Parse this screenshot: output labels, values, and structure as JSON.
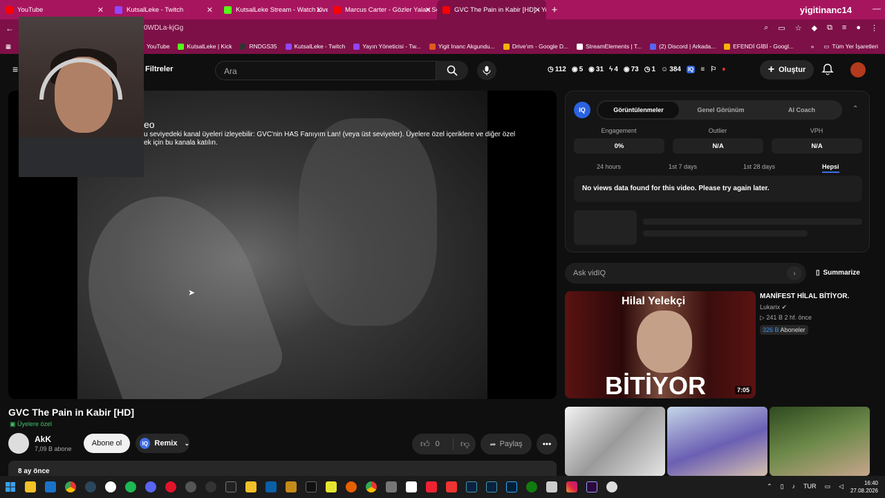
{
  "browser": {
    "tabs": [
      {
        "label": "YouTube",
        "color": "#ff0000"
      },
      {
        "label": "KutsalLeke - Twitch",
        "color": "#9146ff"
      },
      {
        "label": "KutsalLeke Stream - Watch Live",
        "color": "#53fc18"
      },
      {
        "label": "Marcus Carter - Gözler Yalan Sö",
        "color": "#ff0000"
      },
      {
        "label": "GVC The Pain in Kabir [HD] - Yo",
        "color": "#ff0000"
      }
    ],
    "brand_overlay": "yigitinanc14",
    "url": "0WDLa-kjGg",
    "bookmarks": [
      {
        "label": "YouTube",
        "color": "#ff0000"
      },
      {
        "label": "KutsalLeke | Kick",
        "color": "#53fc18"
      },
      {
        "label": "RNDGS35",
        "color": "#111111"
      },
      {
        "label": "KutsalLeke - Twitch",
        "color": "#9146ff"
      },
      {
        "label": "Yayın Yöneticisi - Tw...",
        "color": "#9146ff"
      },
      {
        "label": "Yigit Inanc Akgundu...",
        "color": "#e05a1e"
      },
      {
        "label": "Drive'ım - Google D...",
        "color": "#f4b400"
      },
      {
        "label": "StreamElements | T...",
        "color": "#ffffff"
      },
      {
        "label": "(2) Discord | Arkada...",
        "color": "#5865f2"
      },
      {
        "label": "EFENDİ GİBİ - Googl...",
        "color": "#f4b400"
      }
    ],
    "all_bookmarks": "Tüm Yer İşaretleri"
  },
  "youtube": {
    "filters_label": "Filtreler",
    "search_placeholder": "Ara",
    "stats": [
      "112",
      "5",
      "31",
      "4",
      "73",
      "1",
      "384"
    ],
    "create_label": "Oluştur"
  },
  "player": {
    "members_title": "eo",
    "members_text": "u seviyedeki kanal üyeleri izleyebilir: GVC'nin HAS Fanıyım Lan! (veya üst seviyeler). Üyelere özel içeriklere ve diğer özel ek için bu kanala katılın."
  },
  "video": {
    "title": "GVC The Pain in Kabir [HD]",
    "badge": "Üyelere özel",
    "channel": "AkK",
    "subscribers": "7,09 B abone",
    "subscribe_label": "Abone ol",
    "remix_label": "Remix",
    "likes": "0",
    "share_label": "Paylaş",
    "date": "8 ay önce"
  },
  "vidiq": {
    "tabs": [
      "Görüntülenmeler",
      "Genel Görünüm",
      "AI Coach"
    ],
    "metrics": [
      {
        "label": "Engagement",
        "value": "0%"
      },
      {
        "label": "Outlier",
        "value": "N/A"
      },
      {
        "label": "VPH",
        "value": "N/A"
      }
    ],
    "periods": [
      "24 hours",
      "1st 7 days",
      "1st 28 days",
      "Hepsi"
    ],
    "no_data": "No views data found for this video. Please try again later.",
    "ask_placeholder": "Ask vidIQ",
    "summarize_label": "Summarize"
  },
  "recommendation": {
    "thumb_top": "Hilal Yelekçi",
    "thumb_big": "BİTİYOR",
    "duration": "7:05",
    "title": "MANİFEST HİLAL BİTİYOR.",
    "channel": "Lukarix",
    "meta": "241 B  2 hf. önce",
    "subs_value": "326 B",
    "subs_label": "Aboneler"
  },
  "taskbar": {
    "lang": "TUR",
    "time": "16:40",
    "date": "27.08.2026"
  }
}
